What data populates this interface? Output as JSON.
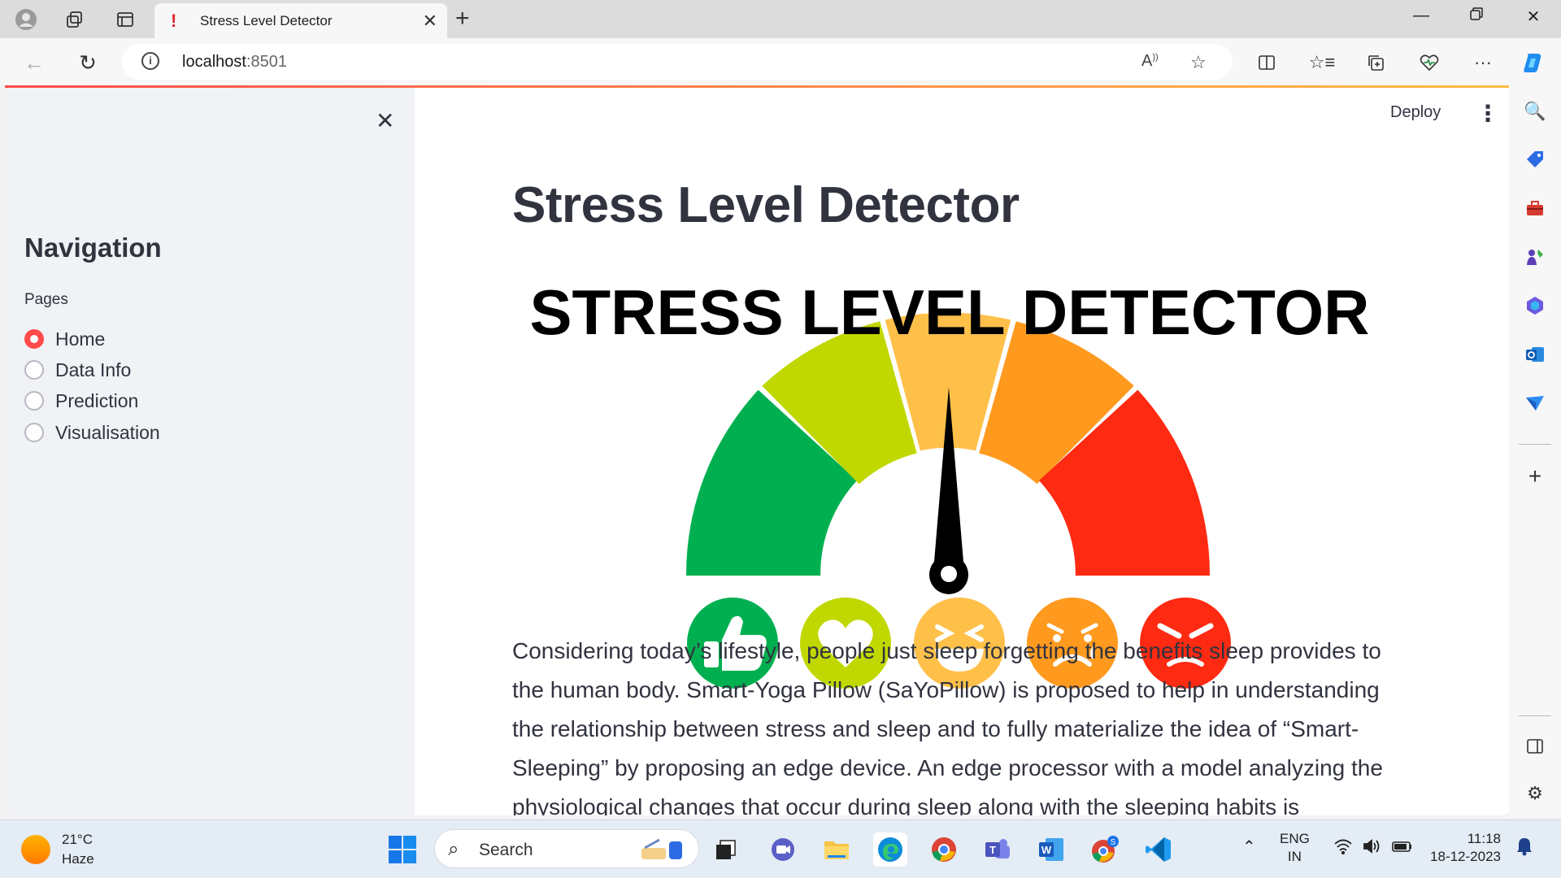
{
  "browser": {
    "tab_title": "Stress Level Detector",
    "url_host": "localhost",
    "url_port": ":8501"
  },
  "sidebar": {
    "heading": "Navigation",
    "pages_label": "Pages",
    "options": [
      "Home",
      "Data Info",
      "Prediction",
      "Visualisation"
    ],
    "selected": "Home"
  },
  "header": {
    "deploy_label": "Deploy"
  },
  "main": {
    "title": "Stress Level Detector",
    "banner_text": "STRESS LEVEL DETECTOR",
    "paragraph_lines": [
      "Considering today’s lifestyle, people just sleep forgetting the benefits sleep provides to",
      "the human body. Smart-Yoga Pillow (SaYoPillow) is proposed to help in understanding",
      "the relationship between stress and sleep and to fully materialize the idea of “Smart-",
      "Sleeping” by proposing an edge device. An edge processor with a model analyzing the",
      "physiological changes that occur during sleep along with the sleeping habits is"
    ],
    "gauge_colors": [
      "#00b050",
      "#c0d800",
      "#ffc04a",
      "#ff9a1f",
      "#ff2a12"
    ]
  },
  "taskbar": {
    "temperature": "21°C",
    "condition": "Haze",
    "search_placeholder": "Search",
    "language": "ENG",
    "region": "IN",
    "time": "11:18",
    "date": "18-12-2023"
  }
}
